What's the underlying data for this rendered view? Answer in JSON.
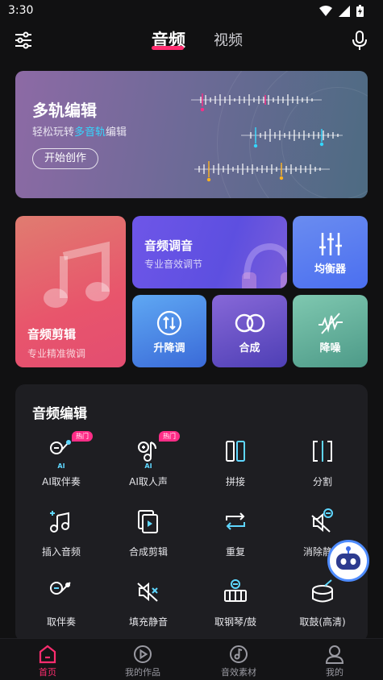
{
  "status_bar": {
    "time": "3:30"
  },
  "top_nav": {
    "tabs": [
      {
        "label": "音频"
      },
      {
        "label": "视频"
      }
    ]
  },
  "banner": {
    "title": "多轨编辑",
    "subtitle_prefix": "轻松玩转",
    "subtitle_highlight": "多音轨",
    "subtitle_suffix": "编辑",
    "button": "开始创作"
  },
  "cards": {
    "audio_cut": {
      "title": "音频剪辑",
      "subtitle": "专业精准微调"
    },
    "audio_tune": {
      "title": "音频调音",
      "subtitle": "专业音效调节"
    },
    "equalizer": {
      "label": "均衡器"
    },
    "pitch": {
      "label": "升降调"
    },
    "mix": {
      "label": "合成"
    },
    "denoise": {
      "label": "降噪"
    }
  },
  "edit_panel": {
    "title": "音频编辑",
    "hot_badge": "热门",
    "ai_badge": "AI",
    "items": [
      {
        "label": "AI取伴奏",
        "icon": "ai-mic-icon"
      },
      {
        "label": "AI取人声",
        "icon": "ai-voice-icon"
      },
      {
        "label": "拼接",
        "icon": "splice-icon"
      },
      {
        "label": "分割",
        "icon": "split-icon"
      },
      {
        "label": "插入音频",
        "icon": "insert-audio-icon"
      },
      {
        "label": "合成剪辑",
        "icon": "merge-clip-icon"
      },
      {
        "label": "重复",
        "icon": "repeat-icon"
      },
      {
        "label": "消除静音",
        "icon": "remove-silence-icon"
      },
      {
        "label": "取伴奏",
        "icon": "mic-icon"
      },
      {
        "label": "填充静音",
        "icon": "fill-silence-icon"
      },
      {
        "label": "取钢琴/鼓",
        "icon": "piano-icon"
      },
      {
        "label": "取鼓(高清)",
        "icon": "drum-icon"
      }
    ]
  },
  "bottom_nav": [
    {
      "label": "首页",
      "active": true
    },
    {
      "label": "我的作品"
    },
    {
      "label": "音效素材"
    },
    {
      "label": "我的"
    }
  ],
  "colors": {
    "accent": "#ff2d6f",
    "highlight": "#34d7ff",
    "icon": "#5fd7ff"
  }
}
